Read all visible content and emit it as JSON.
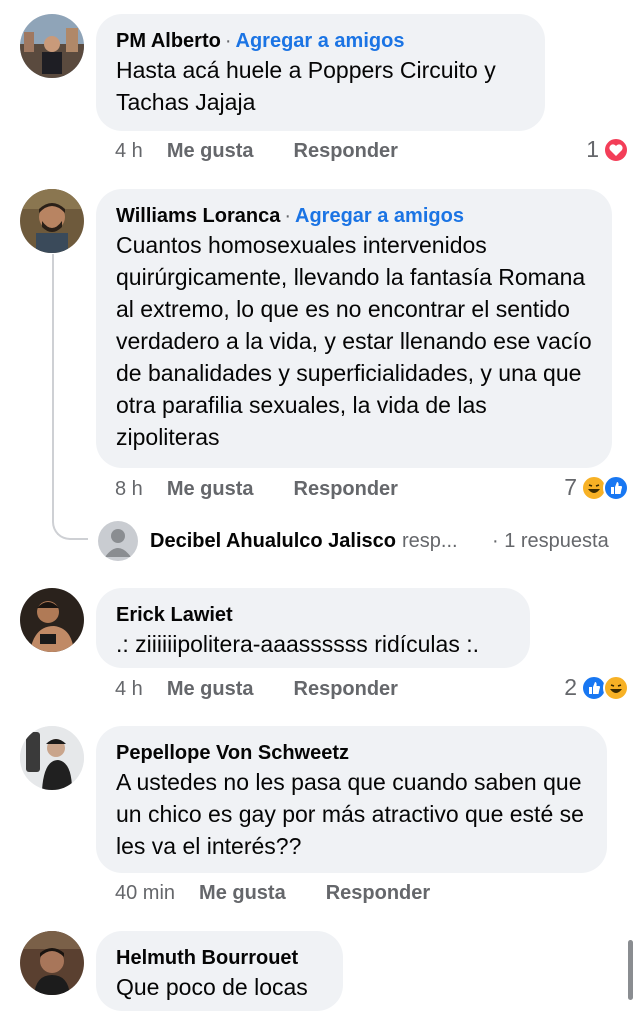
{
  "comments": [
    {
      "name": "PM Alberto",
      "add_friend": "Agregar a amigos",
      "text": "Hasta acá huele a Poppers Circuito y Tachas Jajaja",
      "time": "4 h",
      "like": "Me gusta",
      "reply": "Responder",
      "reaction_count": "1",
      "reactions": [
        "love-icon"
      ]
    },
    {
      "name": "Williams Loranca",
      "add_friend": "Agregar a amigos",
      "text": "Cuantos homosexuales intervenidos quirúrgicamente, llevando la fantasía Romana al extremo, lo que es no encontrar el sentido verdadero a la vida, y estar llenando ese vacío de banalidades y superficialidades, y una que otra parafilia sexuales, la vida de las zipoliteras",
      "time": "8 h",
      "like": "Me gusta",
      "reply": "Responder",
      "reaction_count": "7",
      "reactions": [
        "haha-icon",
        "like-icon"
      ],
      "reply_preview": {
        "name": "Decibel Ahualulco Jalisco",
        "rest": "resp...",
        "count": "· 1 respuesta"
      }
    },
    {
      "name": "Erick Lawiet",
      "text": ".: ziiiiiipolitera-aaassssss ridículas :.",
      "time": "4 h",
      "like": "Me gusta",
      "reply": "Responder",
      "reaction_count": "2",
      "reactions": [
        "like-icon",
        "haha-icon"
      ]
    },
    {
      "name": "Pepellope Von Schweetz",
      "text": "A ustedes no les pasa que cuando saben que un chico es gay por más atractivo que esté se les va el interés??",
      "time": "40 min",
      "like": "Me gusta",
      "reply": "Responder"
    },
    {
      "name": "Helmuth Bourrouet",
      "text": "Que poco de locas"
    }
  ],
  "colors": {
    "bubble": "#f0f2f5",
    "link": "#1b74e4",
    "secondary": "#65676b",
    "love": "#f33e58",
    "like": "#1877f2",
    "haha": "#f7b125"
  }
}
